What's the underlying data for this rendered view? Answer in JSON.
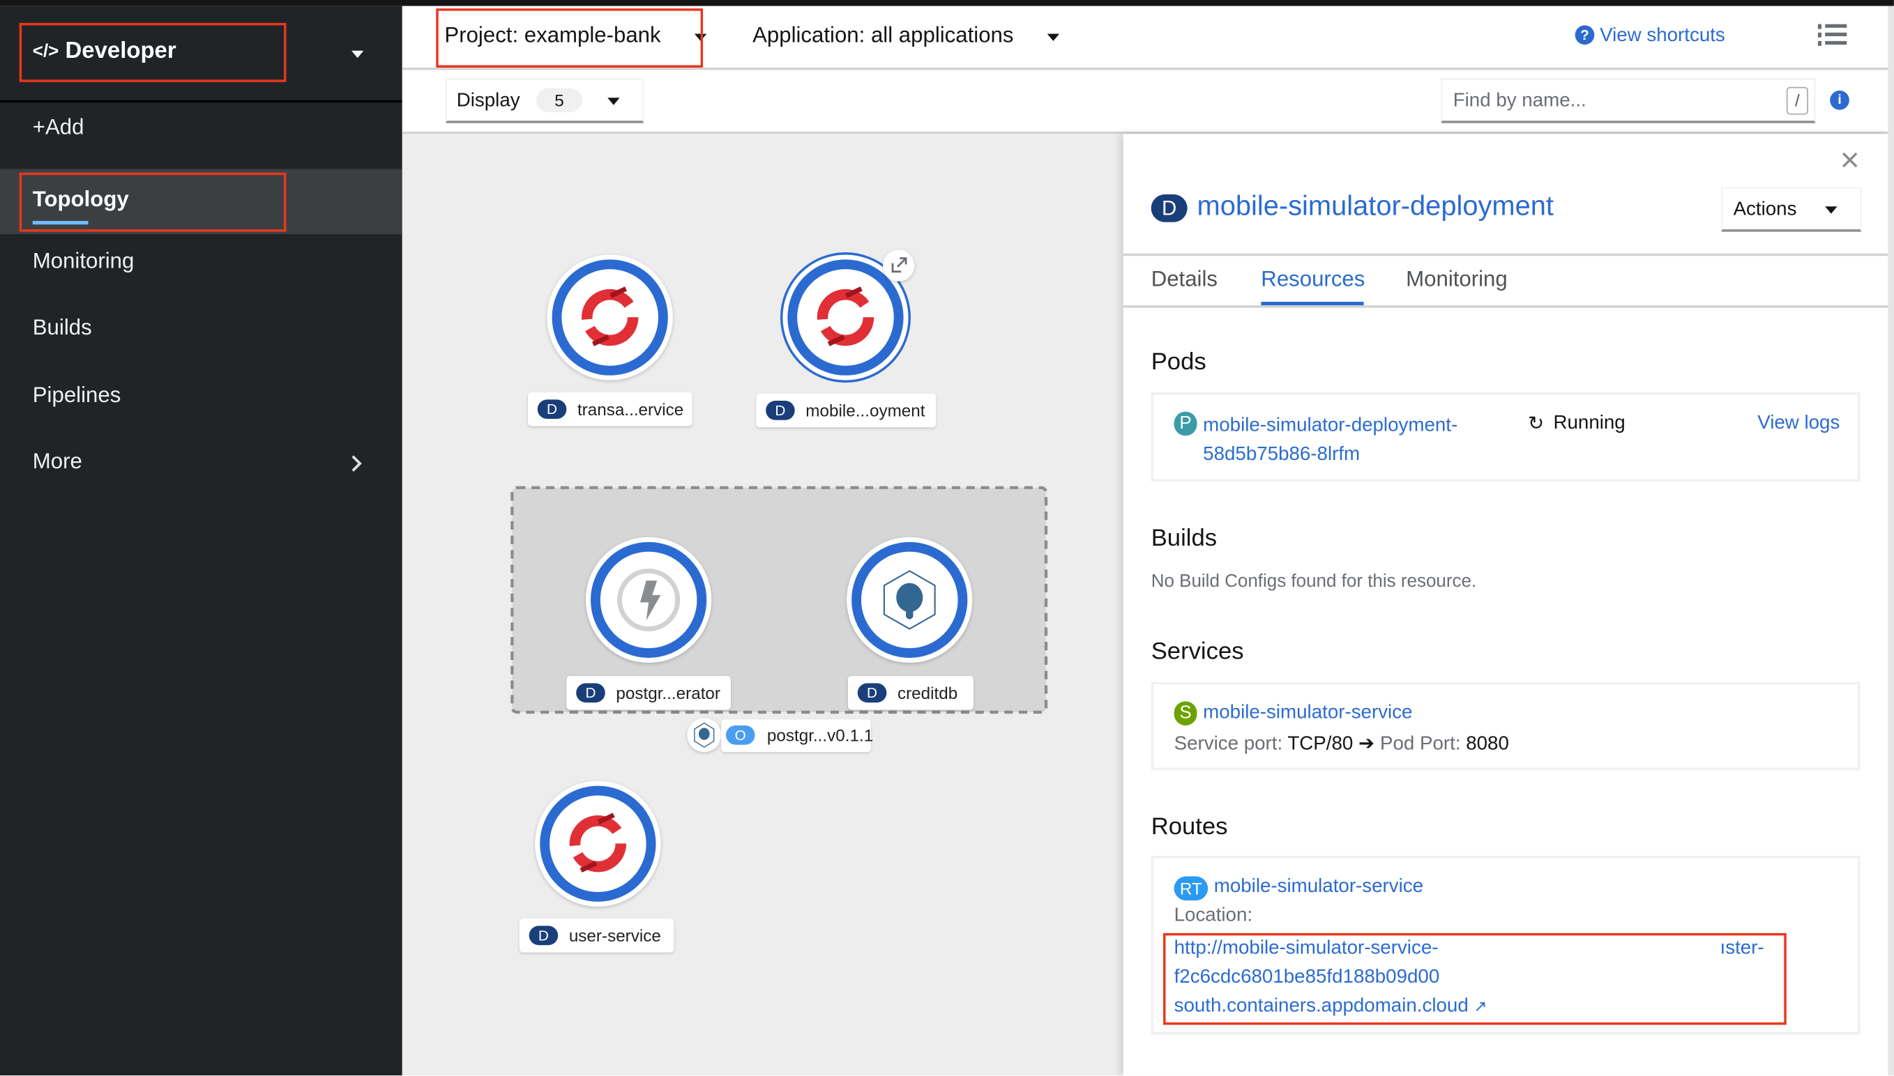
{
  "perspective": {
    "icon": "code-icon",
    "label": "Developer"
  },
  "sidebar": {
    "items": [
      {
        "label": "+Add"
      },
      {
        "label": "Topology",
        "active": true
      },
      {
        "label": "Monitoring"
      },
      {
        "label": "Builds"
      },
      {
        "label": "Pipelines"
      },
      {
        "label": "More"
      }
    ]
  },
  "header": {
    "project": "Project: example-bank",
    "application": "Application: all applications",
    "view_shortcuts": "View shortcuts"
  },
  "toolbar": {
    "display_label": "Display",
    "display_count": "5",
    "find_placeholder": "Find by name...",
    "find_shortcut": "/"
  },
  "topology": {
    "nodes": [
      {
        "badge": "D",
        "label": "transa...ervice"
      },
      {
        "badge": "D",
        "label": "mobile...oyment"
      },
      {
        "badge": "D",
        "label": "postgr...erator"
      },
      {
        "badge": "D",
        "label": "creditdb"
      },
      {
        "badge": "D",
        "label": "user-service"
      }
    ],
    "group": {
      "badge": "O",
      "label": "postgr...v0.1.1"
    }
  },
  "panel": {
    "badge": "D",
    "title": "mobile-simulator-deployment",
    "actions": "Actions",
    "tabs": [
      "Details",
      "Resources",
      "Monitoring"
    ],
    "active_tab": "Resources",
    "pods": {
      "heading": "Pods",
      "badge": "P",
      "name_line1": "mobile-simulator-deployment-",
      "name_line2": "58d5b75b86-8lrfm",
      "status": "Running",
      "view_logs": "View logs"
    },
    "builds": {
      "heading": "Builds",
      "empty": "No Build Configs found for this resource."
    },
    "services": {
      "heading": "Services",
      "badge": "S",
      "name": "mobile-simulator-service",
      "service_port_label": "Service port:",
      "service_port": "TCP/80",
      "pod_port_label": "Pod Port:",
      "pod_port": "8080"
    },
    "routes": {
      "heading": "Routes",
      "badge": "RT",
      "name": "mobile-simulator-service",
      "location_label": "Location:",
      "url_line1": "http://mobile-simulator-service-",
      "url_line1_end": "ıster-",
      "url_line2": "f2c6cdc6801be85fd188b09d00",
      "url_line3": "south.containers.appdomain.cloud"
    }
  },
  "colors": {
    "accent": "#2b6bd1",
    "highlight": "#e8371f",
    "sidebar": "#212427",
    "pod": "#3a9ca6",
    "service": "#6ca100",
    "route": "#2b9af3"
  }
}
